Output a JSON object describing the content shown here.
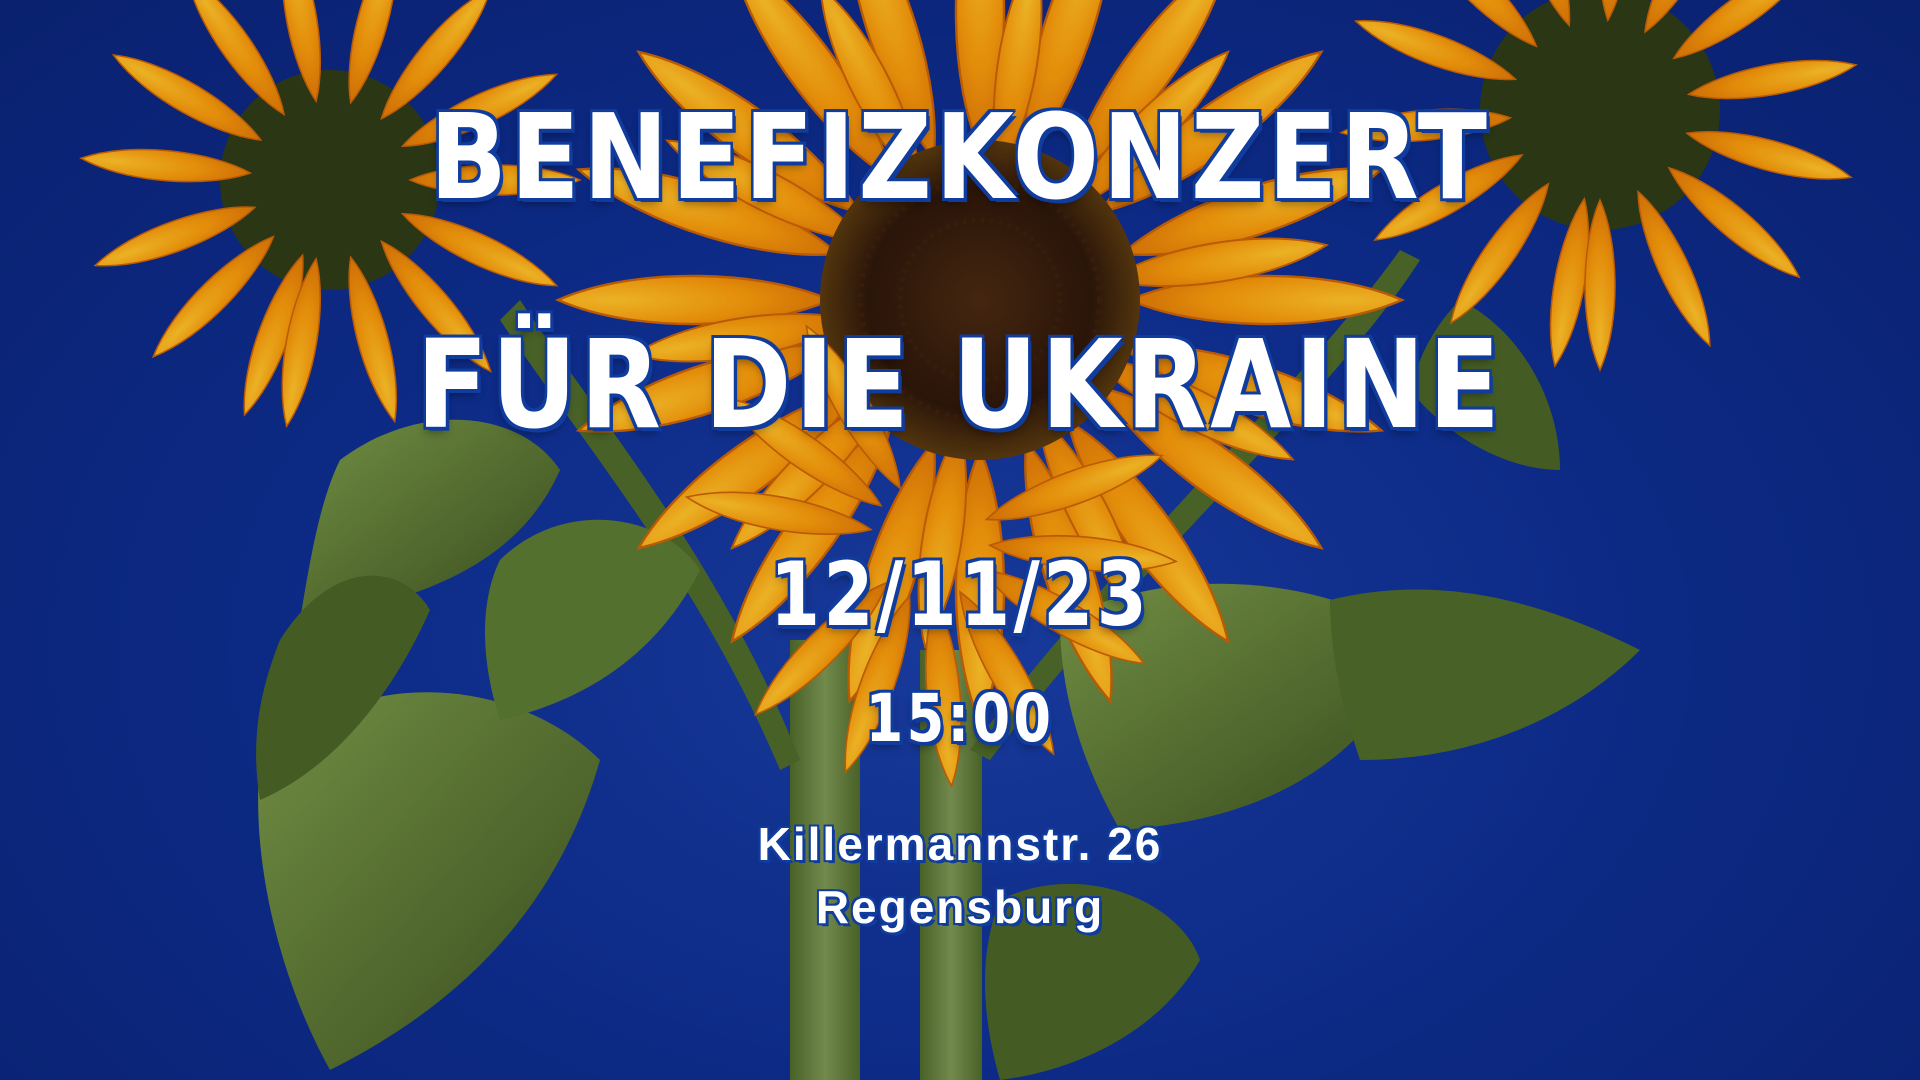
{
  "event": {
    "title_line_1": "BENEFIZKONZERT",
    "title_line_2": "FÜR DIE UKRAINE",
    "date": "12/11/23",
    "time": "15:00",
    "address_street": "Killermannstr. 26",
    "address_city": "Regensburg"
  },
  "colors": {
    "background_blue": "#0f2f93",
    "petal_orange": "#f7a10e",
    "petal_deep_orange": "#e57e07",
    "seed_center": "#3a1e0d",
    "leaf_green": "#5a7a35",
    "text_white": "#ffffff",
    "text_outline_blue": "#103c9e"
  }
}
